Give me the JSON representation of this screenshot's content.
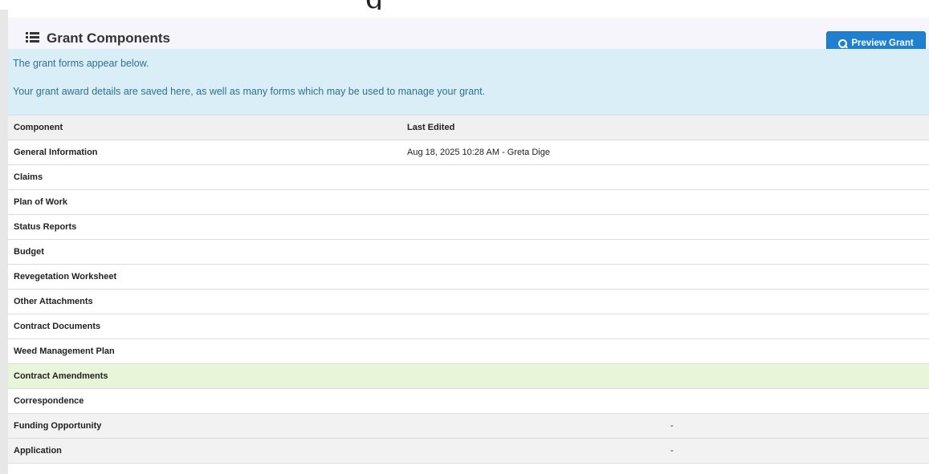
{
  "header": {
    "title": "Grant Components",
    "preview_label": "Preview Grant"
  },
  "info": {
    "line1": "The grant forms appear below.",
    "line2": "Your grant award details are saved here, as well as many forms which may be used to manage your grant."
  },
  "table": {
    "columns": [
      "Component",
      "Last Edited"
    ],
    "rows": [
      {
        "component": "General Information",
        "last_edited": "Aug 18, 2025 10:28 AM - Greta Dige",
        "extra": ""
      },
      {
        "component": "Claims",
        "last_edited": "",
        "extra": ""
      },
      {
        "component": "Plan of Work",
        "last_edited": "",
        "extra": ""
      },
      {
        "component": "Status Reports",
        "last_edited": "",
        "extra": ""
      },
      {
        "component": "Budget",
        "last_edited": "",
        "extra": ""
      },
      {
        "component": "Revegetation Worksheet",
        "last_edited": "",
        "extra": ""
      },
      {
        "component": "Other Attachments",
        "last_edited": "",
        "extra": ""
      },
      {
        "component": "Contract Documents",
        "last_edited": "",
        "extra": ""
      },
      {
        "component": "Weed Management Plan",
        "last_edited": "",
        "extra": ""
      },
      {
        "component": "Contract Amendments",
        "last_edited": "",
        "extra": "",
        "highlight": true
      },
      {
        "component": "Correspondence",
        "last_edited": "",
        "extra": ""
      },
      {
        "component": "Funding Opportunity",
        "last_edited": "",
        "extra": "-"
      },
      {
        "component": "Application",
        "last_edited": "",
        "extra": "-"
      }
    ]
  },
  "colors": {
    "primary_button": "#1f7fd0",
    "info_bg": "#d9eef7",
    "info_text": "#31708f",
    "highlight_row": "#e9f5d9"
  }
}
